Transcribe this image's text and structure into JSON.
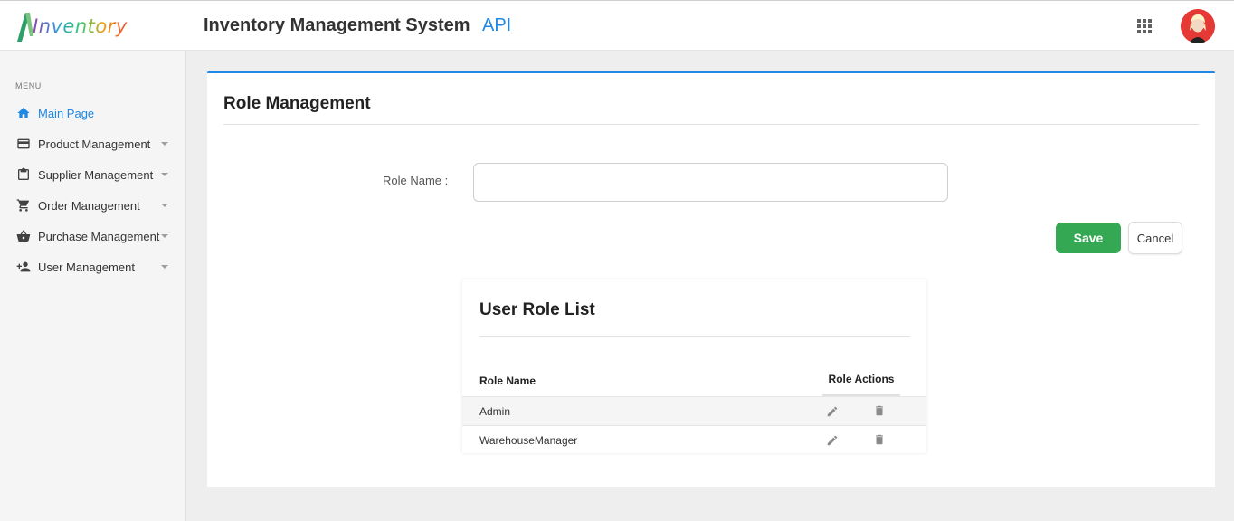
{
  "header": {
    "logo_text": "Inventory",
    "app_title": "Inventory Management System",
    "app_subtitle": "API"
  },
  "sidebar": {
    "menu_heading": "MENU",
    "items": [
      {
        "label": "Main Page",
        "icon": "home-icon",
        "active": true
      },
      {
        "label": "Product Management",
        "icon": "credit-card-icon",
        "expandable": true
      },
      {
        "label": "Supplier Management",
        "icon": "clipboard-icon",
        "expandable": true
      },
      {
        "label": "Order Management",
        "icon": "cart-icon",
        "expandable": true
      },
      {
        "label": "Purchase Management",
        "icon": "basket-icon",
        "expandable": true
      },
      {
        "label": "User Management",
        "icon": "person-add-icon",
        "expandable": true
      }
    ]
  },
  "main": {
    "title": "Role Management",
    "form": {
      "role_name_label": "Role Name :",
      "role_name_value": "",
      "role_name_placeholder": ""
    },
    "save_label": "Save",
    "cancel_label": "Cancel",
    "role_list": {
      "title": "User Role List",
      "columns": [
        "Role Name",
        "Role Actions"
      ],
      "rows": [
        {
          "name": "Admin"
        },
        {
          "name": "WarehouseManager"
        }
      ]
    }
  },
  "colors": {
    "accent": "#1e88e5",
    "save": "#34a853",
    "avatar_bg": "#e53935"
  }
}
